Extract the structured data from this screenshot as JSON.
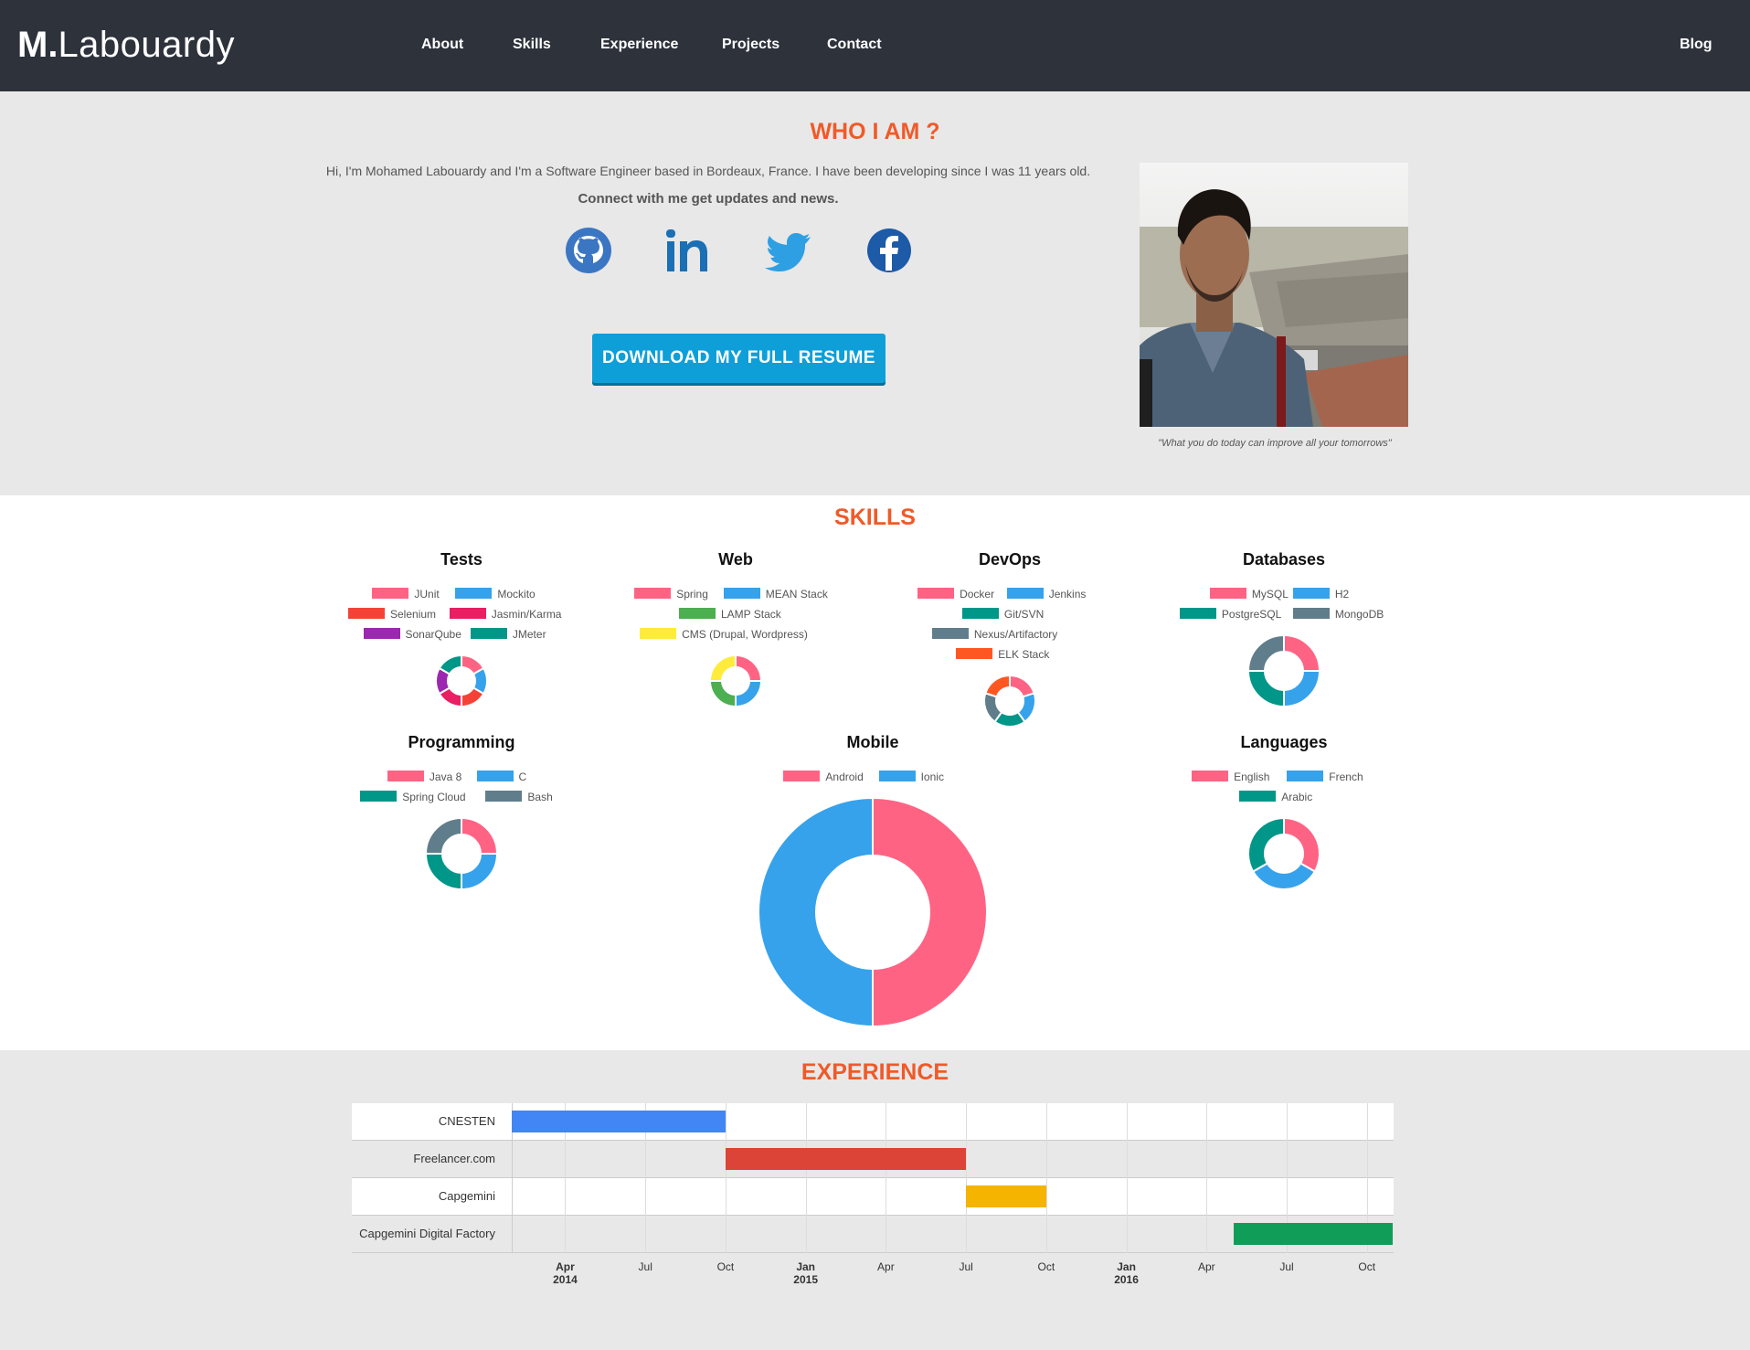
{
  "nav": {
    "brand_bold": "M.",
    "brand_rest": "Labouardy",
    "items": [
      "About",
      "Skills",
      "Experience",
      "Projects",
      "Contact"
    ],
    "blog": "Blog"
  },
  "who": {
    "title": "WHO I AM ?",
    "intro": "Hi, I'm Mohamed Labouardy and I'm a Software Engineer based in Bordeaux, France. I have been developing since I was 11 years old.",
    "connect": "Connect with me get updates and news.",
    "social": [
      "github-icon",
      "linkedin-icon",
      "twitter-icon",
      "facebook-icon"
    ],
    "button": "DOWNLOAD MY FULL RESUME",
    "quote": "\"What you do today can improve all your tomorrows\""
  },
  "skills": {
    "title": "SKILLS",
    "charts": [
      {
        "key": "tests",
        "title": "Tests",
        "labels": [
          "JUnit",
          "Mockito",
          "Selenium",
          "Jasmin/Karma",
          "SonarQube",
          "JMeter"
        ],
        "values": [
          1,
          1,
          1,
          1,
          1,
          1
        ],
        "colors": [
          "#ff6384",
          "#36a2eb",
          "#f44336",
          "#e91e63",
          "#9c27b0",
          "#009688"
        ]
      },
      {
        "key": "web",
        "title": "Web",
        "labels": [
          "Spring",
          "MEAN Stack",
          "LAMP Stack",
          "CMS (Drupal, Wordpress)"
        ],
        "values": [
          1,
          1,
          1,
          1
        ],
        "colors": [
          "#ff6384",
          "#36a2eb",
          "#4caf50",
          "#ffeb3b"
        ]
      },
      {
        "key": "devops",
        "title": "DevOps",
        "labels": [
          "Docker",
          "Jenkins",
          "Git/SVN",
          "Nexus/Artifactory",
          "ELK Stack"
        ],
        "values": [
          1,
          1,
          1,
          1,
          1
        ],
        "colors": [
          "#ff6384",
          "#36a2eb",
          "#009688",
          "#607d8b",
          "#ff5722"
        ]
      },
      {
        "key": "databases",
        "title": "Databases",
        "labels": [
          "MySQL",
          "H2",
          "PostgreSQL",
          "MongoDB"
        ],
        "values": [
          1,
          1,
          1,
          1
        ],
        "colors": [
          "#ff6384",
          "#36a2eb",
          "#009688",
          "#607d8b"
        ]
      },
      {
        "key": "programming",
        "title": "Programming",
        "labels": [
          "Java 8",
          "C",
          "Spring Cloud",
          "Bash"
        ],
        "values": [
          1,
          1,
          1,
          1
        ],
        "colors": [
          "#ff6384",
          "#36a2eb",
          "#009688",
          "#607d8b"
        ]
      },
      {
        "key": "mobile",
        "title": "Mobile",
        "labels": [
          "Android",
          "Ionic"
        ],
        "values": [
          1,
          1
        ],
        "colors": [
          "#ff6384",
          "#36a2eb"
        ]
      },
      {
        "key": "languages",
        "title": "Languages",
        "labels": [
          "English",
          "French",
          "Arabic"
        ],
        "values": [
          1,
          1,
          1
        ],
        "colors": [
          "#ff6384",
          "#36a2eb",
          "#009688"
        ]
      }
    ]
  },
  "experience": {
    "title": "EXPERIENCE",
    "chart_data": {
      "type": "timeline",
      "rows": [
        {
          "label": "CNESTEN",
          "start": "2014-02",
          "end": "2014-10",
          "color": "#4285f4"
        },
        {
          "label": "Freelancer.com",
          "start": "2014-10",
          "end": "2015-07",
          "color": "#db4437"
        },
        {
          "label": "Capgemini",
          "start": "2015-07",
          "end": "2015-10",
          "color": "#f4b400"
        },
        {
          "label": "Capgemini Digital Factory",
          "start": "2016-05",
          "end": "2016-11",
          "color": "#0f9d58"
        }
      ],
      "ticks": [
        {
          "month": "Apr",
          "year": "2014"
        },
        {
          "month": "Jul",
          "year": ""
        },
        {
          "month": "Oct",
          "year": ""
        },
        {
          "month": "Jan",
          "year": "2015"
        },
        {
          "month": "Apr",
          "year": ""
        },
        {
          "month": "Jul",
          "year": ""
        },
        {
          "month": "Oct",
          "year": ""
        },
        {
          "month": "Jan",
          "year": "2016"
        },
        {
          "month": "Apr",
          "year": ""
        },
        {
          "month": "Jul",
          "year": ""
        },
        {
          "month": "Oct",
          "year": ""
        }
      ]
    }
  }
}
